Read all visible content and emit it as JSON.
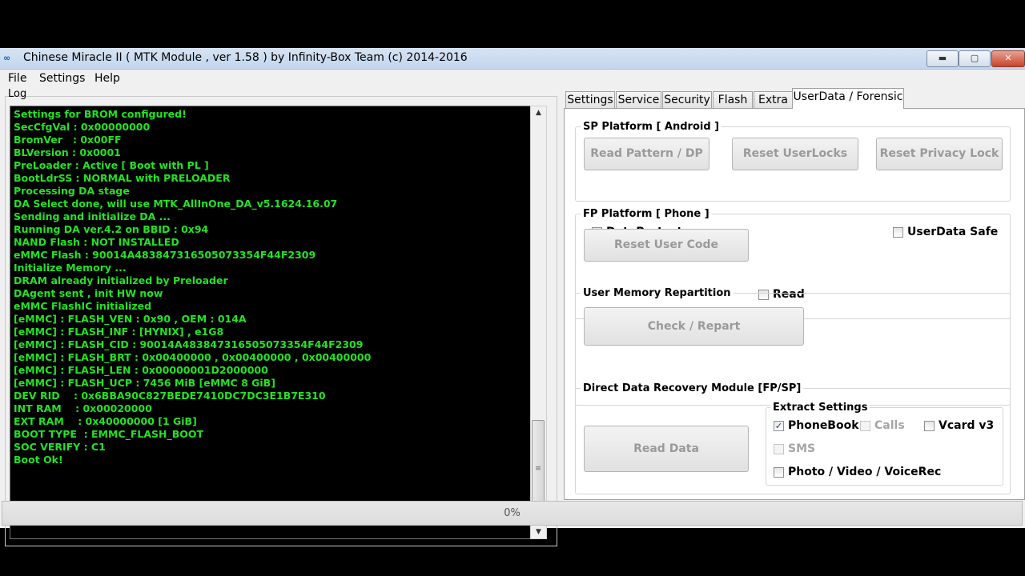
{
  "window": {
    "title": "Chinese Miracle II ( MTK Module , ver 1.58 ) by Infinity-Box Team (c) 2014-2016",
    "app_icon": "infinity-box-icon",
    "buttons": {
      "minimize": "▬",
      "maximize": "▢",
      "close": "✕"
    }
  },
  "menu": {
    "items": [
      "File",
      "Settings",
      "Help"
    ]
  },
  "log": {
    "label": "Log",
    "text_color": "#22e322",
    "background": "#000000",
    "lines": [
      "Settings for BROM configured!",
      "SecCfgVal : 0x00000000",
      "BromVer   : 0x00FF",
      "BLVersion : 0x0001",
      "PreLoader : Active [ Boot with PL ]",
      "BootLdrSS : NORMAL with PRELOADER",
      "Processing DA stage",
      "DA Select done, will use MTK_AllInOne_DA_v5.1624.16.07",
      "Sending and initialize DA ...",
      "Running DA ver.4.2 on BBID : 0x94",
      "NAND Flash : NOT INSTALLED",
      "eMMC Flash : 90014A483847316505073354F44F2309",
      "Initialize Memory ...",
      "DRAM already initialized by Preloader",
      "DAgent sent , init HW now",
      "eMMC FlashIC initialized",
      "[eMMC] : FLASH_VEN : 0x90 , OEM : 014A",
      "[eMMC] : FLASH_INF : [HYNIX] , e1G8",
      "[eMMC] : FLASH_CID : 90014A483847316505073354F44F2309",
      "[eMMC] : FLASH_BRT : 0x00400000 , 0x00400000 , 0x00400000",
      "[eMMC] : FLASH_LEN : 0x00000001D2000000",
      "[eMMC] : FLASH_UCP : 7456 MiB [eMMC 8 GiB]",
      "DEV RID    : 0x6BBA90C827BEDE7410DC7DC3E1B7E310",
      "INT RAM    : 0x00020000",
      "EXT RAM    : 0x40000000 [1 GiB]",
      "BOOT TYPE  : EMMC_FLASH_BOOT",
      "SOC VERIFY : C1",
      "Boot Ok!"
    ]
  },
  "tabs": [
    {
      "label": "Settings",
      "active": false
    },
    {
      "label": "Service",
      "active": false
    },
    {
      "label": "Security",
      "active": false
    },
    {
      "label": "Flash",
      "active": false
    },
    {
      "label": "Extra",
      "active": false
    },
    {
      "label": "UserData / Forensic",
      "active": true
    }
  ],
  "sp_platform": {
    "title": "SP Platform [ Android ]",
    "read_pattern": "Read Pattern / DP",
    "reset_userlocks": "Reset UserLocks",
    "reset_privacy": "Reset Privacy Lock",
    "dataprotect": {
      "label": "DataProtect",
      "checked": false
    },
    "userdata_safe": {
      "label": "UserData Safe",
      "checked": false
    }
  },
  "fp_platform": {
    "title": "FP Platform [ Phone ]",
    "reset_user_code": "Reset User Code",
    "read": {
      "label": "Read",
      "checked": false
    }
  },
  "repartition": {
    "title": "User Memory Repartition",
    "check_repart": "Check / Repart"
  },
  "recovery": {
    "title": "Direct Data Recovery Module  [FP/SP]",
    "read_data": "Read Data",
    "extract_title": "Extract Settings",
    "phonebook": {
      "label": "PhoneBook",
      "checked": true,
      "enabled": true
    },
    "calls": {
      "label": "Calls",
      "checked": false,
      "enabled": false
    },
    "vcard": {
      "label": "Vcard v3",
      "checked": false,
      "enabled": true
    },
    "sms": {
      "label": "SMS",
      "checked": false,
      "enabled": false
    },
    "photo": {
      "label": "Photo / Video / VoiceRec",
      "checked": false,
      "enabled": true
    }
  },
  "progress": {
    "text": "0%",
    "value": 0
  }
}
